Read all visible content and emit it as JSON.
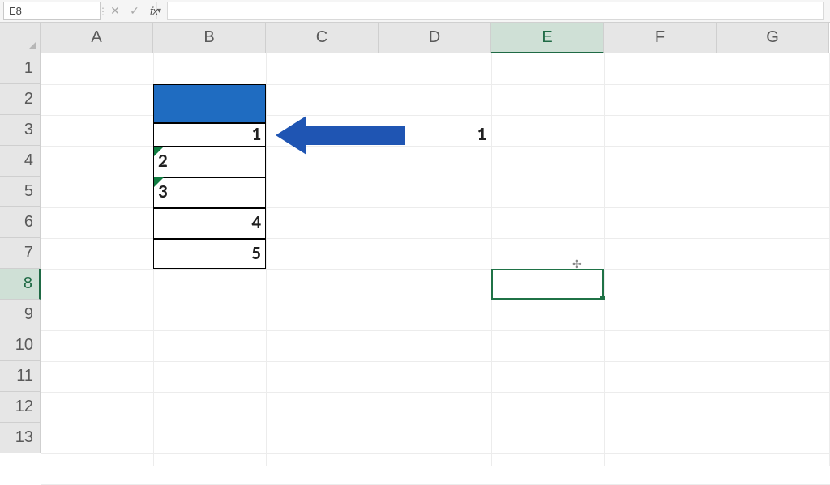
{
  "formula_bar": {
    "cell_ref": "E8",
    "formula_value": "",
    "cancel_glyph": "✕",
    "enter_glyph": "✓",
    "fx_label": "fx"
  },
  "columns": [
    "A",
    "B",
    "C",
    "D",
    "E",
    "F",
    "G"
  ],
  "rows": [
    "1",
    "2",
    "3",
    "4",
    "5",
    "6",
    "7",
    "8",
    "9",
    "10",
    "11",
    "12",
    "13"
  ],
  "active_col_index": 4,
  "active_row_index": 7,
  "cells": {
    "B3": {
      "value": "1",
      "align": "right"
    },
    "B4": {
      "value": "2",
      "align": "left",
      "error_flag": true
    },
    "B5": {
      "value": "3",
      "align": "left",
      "error_flag": true
    },
    "B6": {
      "value": "4",
      "align": "right"
    },
    "B7": {
      "value": "5",
      "align": "right"
    },
    "D3": {
      "value": "1",
      "align": "right"
    }
  },
  "colors": {
    "blue_fill": "#1f6cc1",
    "arrow_blue": "#1f55b3",
    "selection_green": "#1f7246",
    "error_triangle": "#107c41"
  }
}
